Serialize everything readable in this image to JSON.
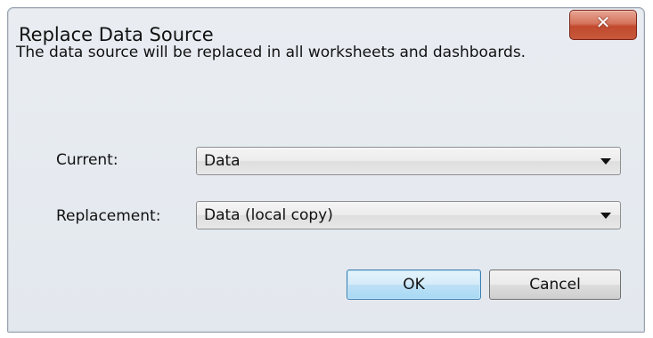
{
  "window": {
    "title": "Replace Data Source",
    "close_icon": "close-icon"
  },
  "message": "The data source will be replaced in all worksheets and dashboards.",
  "fields": {
    "current": {
      "label": "Current:",
      "value": "Data"
    },
    "replacement": {
      "label": "Replacement:",
      "value": "Data (local copy)"
    }
  },
  "buttons": {
    "ok": "OK",
    "cancel": "Cancel"
  },
  "icons": {
    "close": "✕"
  },
  "colors": {
    "close_button": "#c7583c",
    "ok_button": "#bde0f5"
  }
}
